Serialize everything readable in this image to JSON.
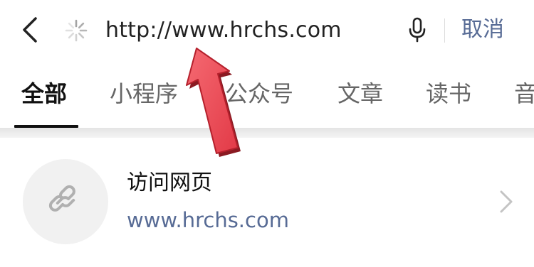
{
  "search_bar": {
    "back_icon": "chevron-left-icon",
    "loading_icon": "loading-spinner-icon",
    "query": "http://www.hrchs.com",
    "mic_icon": "microphone-icon",
    "cancel_label": "取消"
  },
  "tabs": [
    {
      "label": "全部",
      "active": true
    },
    {
      "label": "小程序",
      "active": false
    },
    {
      "label": "公众号",
      "active": false
    },
    {
      "label": "文章",
      "active": false
    },
    {
      "label": "读书",
      "active": false
    },
    {
      "label": "音",
      "active": false
    }
  ],
  "result": {
    "icon": "link-icon",
    "title": "访问网页",
    "url": "www.hrchs.com",
    "chevron_icon": "chevron-right-icon"
  },
  "annotation": {
    "icon": "red-arrow-up-icon",
    "color": "#e8434f"
  },
  "colors": {
    "link_blue": "#576b95",
    "text_dark": "#111111",
    "text_muted": "#666666"
  }
}
